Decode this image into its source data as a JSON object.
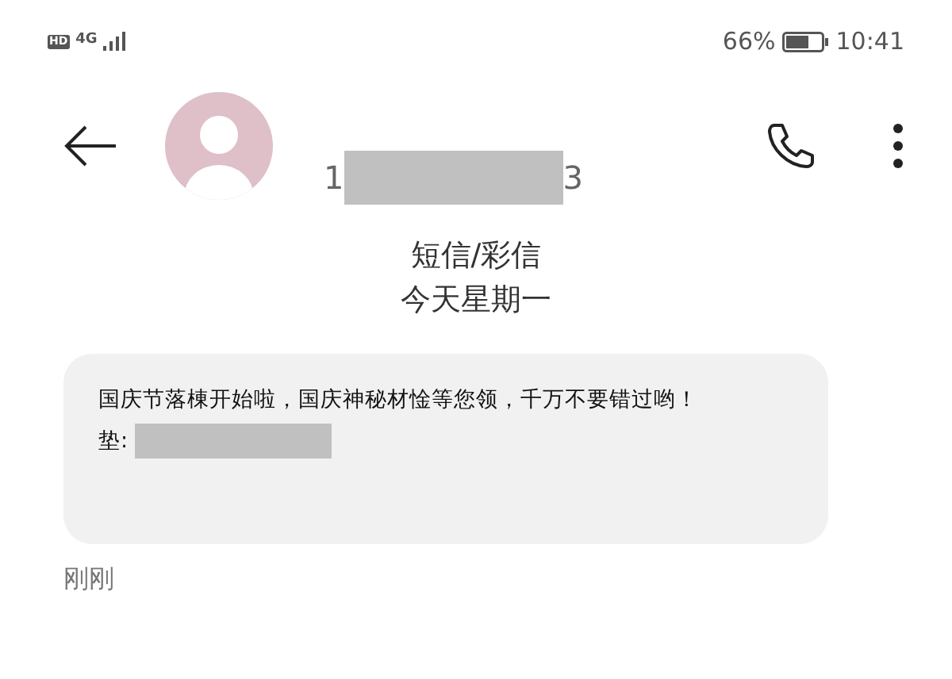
{
  "status_bar": {
    "hd": "HD",
    "network": "4G",
    "battery_text": "66%",
    "time": "10:41"
  },
  "header": {
    "number_start": "1",
    "number_end": "3"
  },
  "conversation": {
    "channel": "短信/彩信",
    "day": "今天星期一"
  },
  "messages": [
    {
      "line1": "国庆节落棟开始啦，国庆神秘材惍等您领，千万不要错过哟！",
      "line2_label": "垫:",
      "time": "刚刚"
    }
  ]
}
